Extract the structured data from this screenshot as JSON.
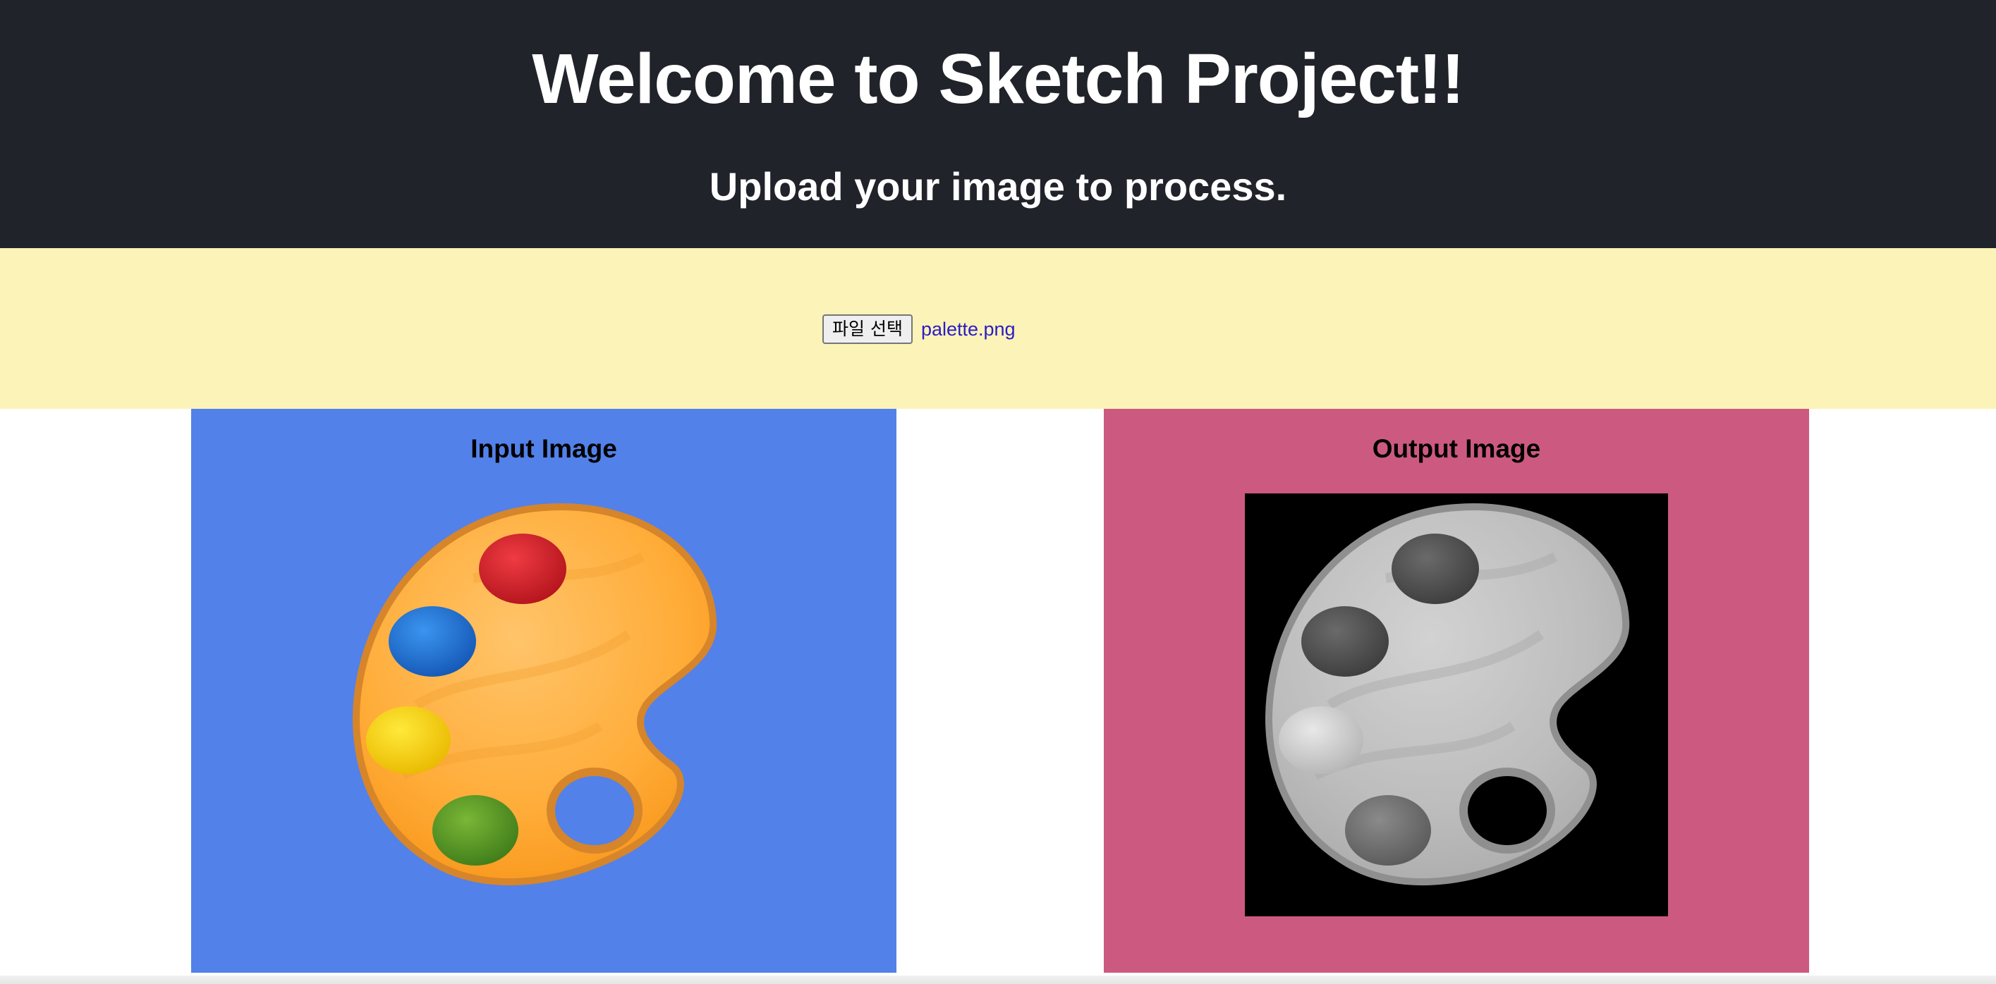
{
  "header": {
    "title": "Welcome to Sketch Project!!",
    "subtitle": "Upload your image to process."
  },
  "upload": {
    "button_label": "파일 선택",
    "file_name": "palette.png"
  },
  "panels": [
    {
      "title": "Input Image",
      "image_icon": "palette-icon",
      "image_style": "color"
    },
    {
      "title": "Output Image",
      "image_icon": "palette-icon",
      "image_style": "grayscale-sketch"
    }
  ],
  "colors": {
    "header_bg": "#20232a",
    "upload_bg": "#fbf3b8",
    "input_panel_bg": "#5281e9",
    "output_panel_bg": "#cc5a80",
    "output_image_bg": "#000000"
  }
}
